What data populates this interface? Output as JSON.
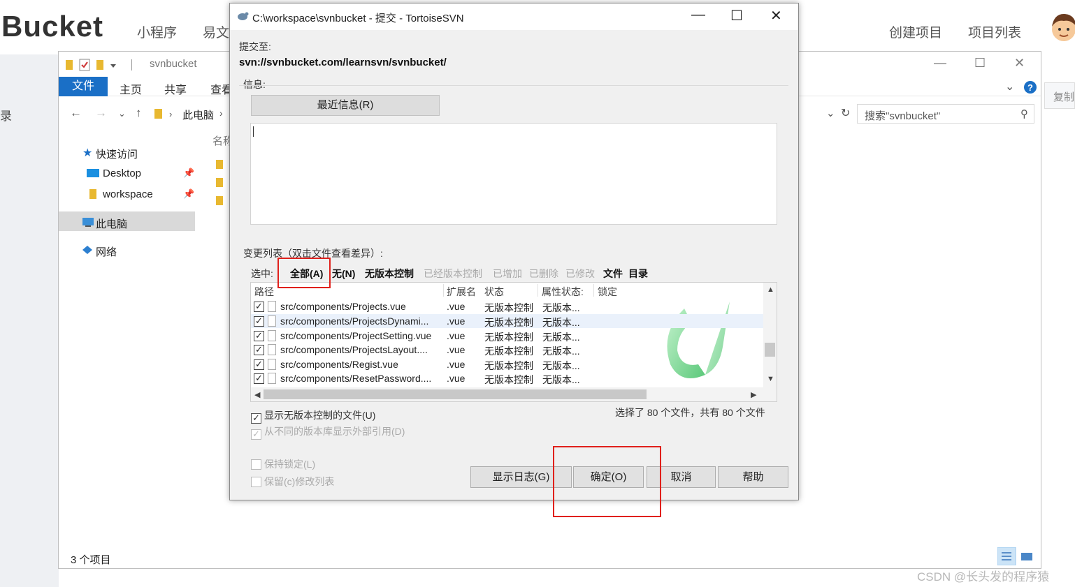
{
  "site": {
    "logo": "Bucket",
    "nav_left": [
      "小程序",
      "易文"
    ],
    "nav_right": [
      "创建项目",
      "项目列表"
    ],
    "left_strip_text": "录",
    "right_copy": "复制"
  },
  "explorer": {
    "title": "svnbucket",
    "ribbon_tabs": [
      "文件",
      "主页",
      "共享",
      "查看"
    ],
    "address_pc": "此电脑",
    "search_placeholder": "搜索\"svnbucket\"",
    "nav_items": [
      "快速访问",
      "Desktop",
      "workspace",
      "此电脑",
      "网络"
    ],
    "column_name": "名称",
    "status": "3 个项目"
  },
  "dialog": {
    "title": "C:\\workspace\\svnbucket - 提交 - TortoiseSVN",
    "commit_to_label": "提交至:",
    "url": "svn://svnbucket.com/learnsvn/svnbucket/",
    "message_label": "信息:",
    "recent_button": "最近信息(R)",
    "changes_label": "变更列表（双击文件查看差异）:",
    "select_label": "选中:",
    "filters": [
      {
        "label": "全部(A)",
        "enabled": true
      },
      {
        "label": "无(N)",
        "enabled": true
      },
      {
        "label": "无版本控制",
        "enabled": true
      },
      {
        "label": "已经版本控制",
        "enabled": false
      },
      {
        "label": "已增加",
        "enabled": false
      },
      {
        "label": "已删除",
        "enabled": false
      },
      {
        "label": "已修改",
        "enabled": false
      },
      {
        "label": "文件",
        "enabled": true
      },
      {
        "label": "目录",
        "enabled": true
      }
    ],
    "columns": [
      "路径",
      "扩展名",
      "状态",
      "属性状态:",
      "锁定"
    ],
    "rows": [
      {
        "path": "src/components/Projects.vue",
        "ext": ".vue",
        "status": "无版本控制",
        "prop": "无版本..."
      },
      {
        "path": "src/components/ProjectsDynami...",
        "ext": ".vue",
        "status": "无版本控制",
        "prop": "无版本..."
      },
      {
        "path": "src/components/ProjectSetting.vue",
        "ext": ".vue",
        "status": "无版本控制",
        "prop": "无版本..."
      },
      {
        "path": "src/components/ProjectsLayout....",
        "ext": ".vue",
        "status": "无版本控制",
        "prop": "无版本..."
      },
      {
        "path": "src/components/Regist.vue",
        "ext": ".vue",
        "status": "无版本控制",
        "prop": "无版本..."
      },
      {
        "path": "src/components/ResetPassword....",
        "ext": ".vue",
        "status": "无版本控制",
        "prop": "无版本..."
      }
    ],
    "show_unversioned": "显示无版本控制的文件(U)",
    "show_externals": "从不同的版本库显示外部引用(D)",
    "summary": "选择了 80 个文件，共有 80 个文件",
    "keep_locks": "保持锁定(L)",
    "keep_changelists": "保留(c)修改列表",
    "buttons": {
      "log": "显示日志(G)",
      "ok": "确定(O)",
      "cancel": "取消",
      "help": "帮助"
    }
  },
  "watermark": "CSDN @长头发的程序猿"
}
